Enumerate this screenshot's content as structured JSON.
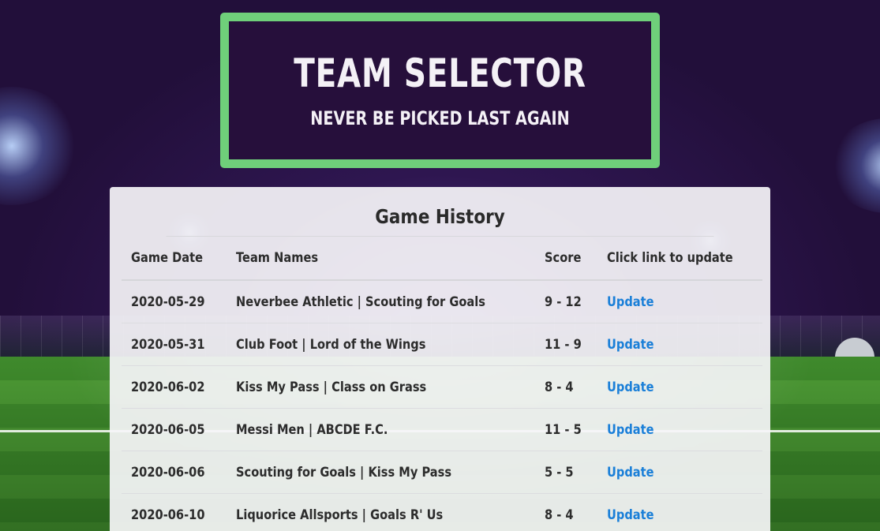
{
  "header": {
    "title": "TEAM SELECTOR",
    "subtitle": "NEVER BE PICKED LAST AGAIN"
  },
  "game_history": {
    "heading": "Game History",
    "columns": [
      "Game Date",
      "Team Names",
      "Score",
      "Click link to update"
    ],
    "rows": [
      {
        "date": "2020-05-29",
        "teams": "Neverbee Athletic | Scouting for Goals",
        "score": "9 - 12",
        "link": "Update"
      },
      {
        "date": "2020-05-31",
        "teams": "Club Foot | Lord of the Wings",
        "score": "11 - 9",
        "link": "Update"
      },
      {
        "date": "2020-06-02",
        "teams": "Kiss My Pass | Class on Grass",
        "score": "8 - 4",
        "link": "Update"
      },
      {
        "date": "2020-06-05",
        "teams": "Messi Men | ABCDE F.C.",
        "score": "11 - 5",
        "link": "Update"
      },
      {
        "date": "2020-06-06",
        "teams": "Scouting for Goals | Kiss My Pass",
        "score": "5 - 5",
        "link": "Update"
      },
      {
        "date": "2020-06-10",
        "teams": "Liquorice Allsports | Goals R' Us",
        "score": "8 - 4",
        "link": "Update"
      }
    ]
  },
  "colors": {
    "header_border": "#6fcf7a",
    "header_background": "#260f3b",
    "link": "#1a7fd8"
  }
}
